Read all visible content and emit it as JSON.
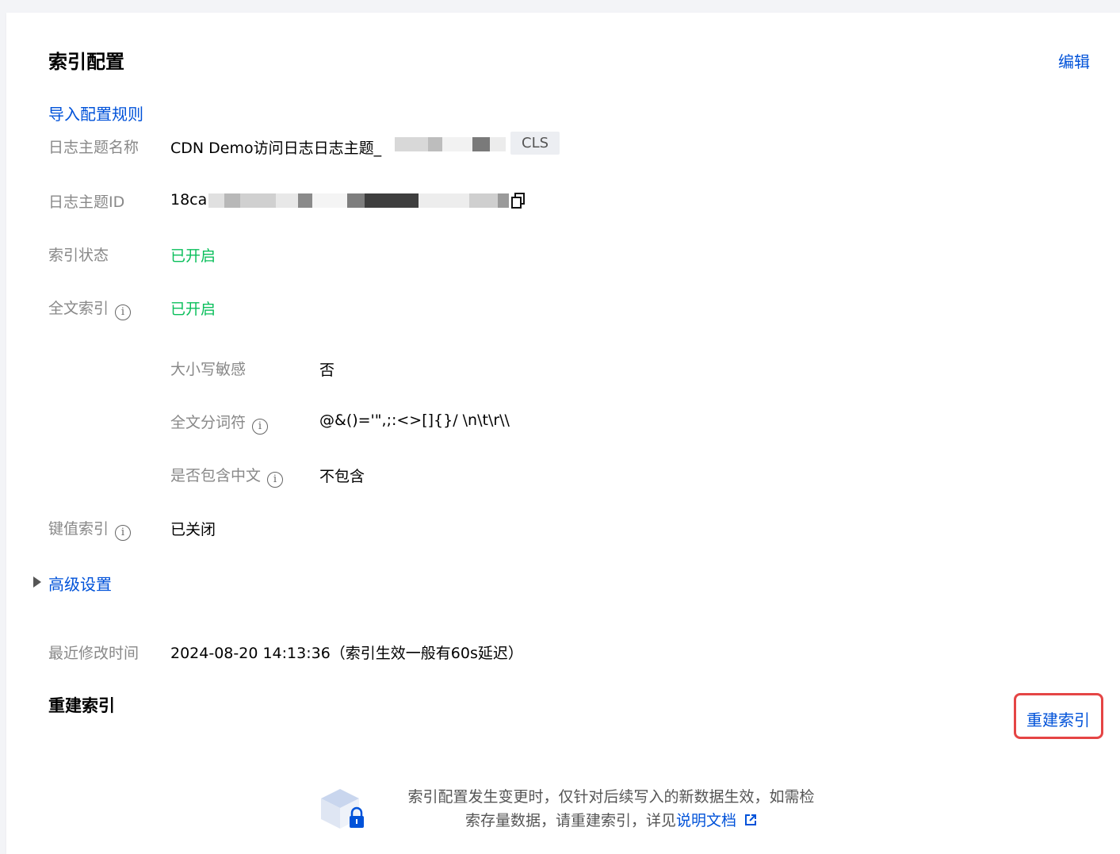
{
  "header": {
    "title": "索引配置",
    "edit_label": "编辑"
  },
  "import_rules_label": "导入配置规则",
  "fields": {
    "topic_name": {
      "label": "日志主题名称",
      "value": "CDN Demo访问日志日志主题_",
      "tag": "CLS"
    },
    "topic_id": {
      "label": "日志主题ID",
      "value": "18ca"
    },
    "index_status": {
      "label": "索引状态",
      "value": "已开启"
    },
    "fulltext_index": {
      "label": "全文索引",
      "value": "已开启"
    },
    "case_sensitive": {
      "label": "大小写敏感",
      "value": "否"
    },
    "tokenizer": {
      "label": "全文分词符",
      "value": "@&()='\",;:<>[]{}/ \\n\\t\\r\\\\"
    },
    "include_chinese": {
      "label": "是否包含中文",
      "value": "不包含"
    },
    "kv_index": {
      "label": "键值索引",
      "value": "已关闭"
    }
  },
  "advanced_settings_label": "高级设置",
  "last_modified": {
    "label": "最近修改时间",
    "value": "2024-08-20 14:13:36（索引生效一般有60s延迟）"
  },
  "rebuild": {
    "section_title": "重建索引",
    "button_label": "重建索引",
    "notice_line1": "索引配置发生变更时，仅针对后续写入的新数据生效，如需检",
    "notice_line2": "索存量数据，请重建索引，详见",
    "doc_link": "说明文档"
  },
  "icons": {
    "info": "info-icon",
    "copy": "copy-icon",
    "external": "external-link-icon",
    "box": "box-lock-icon"
  },
  "colors": {
    "link": "#0052d9",
    "green": "#0abf5b",
    "highlight": "#e54545"
  }
}
